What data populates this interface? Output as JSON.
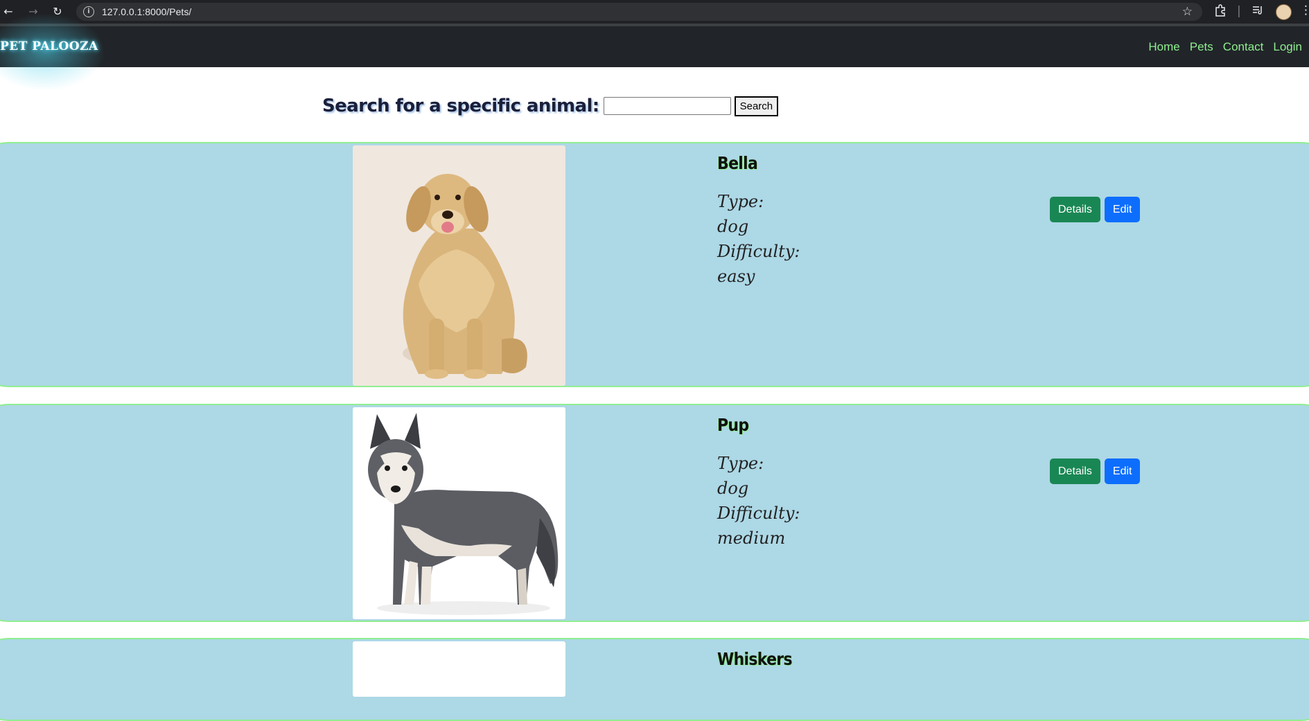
{
  "browser": {
    "back_icon": "←",
    "forward_icon": "→",
    "reload_icon": "↻",
    "info_icon": "i",
    "url": "127.0.0.1:8000/Pets/",
    "star_icon": "☆"
  },
  "site": {
    "brand": "PET PALOOZA",
    "nav": [
      "Home",
      "Pets",
      "Contact",
      "Login"
    ],
    "accent_color": "#90ee90",
    "card_color": "#add8e6"
  },
  "search": {
    "label": "Search for a specific animal:",
    "input_value": "",
    "button": "Search"
  },
  "pets": [
    {
      "name": "Bella",
      "type_label": "Type:",
      "type": "dog",
      "difficulty_label": "Difficulty:",
      "difficulty": "easy",
      "details_label": "Details",
      "edit_label": "Edit",
      "photo": "golden-retriever"
    },
    {
      "name": "Pup",
      "type_label": "Type:",
      "type": "dog",
      "difficulty_label": "Difficulty:",
      "difficulty": "medium",
      "details_label": "Details",
      "edit_label": "Edit",
      "photo": "husky"
    },
    {
      "name": "Whiskers"
    }
  ]
}
